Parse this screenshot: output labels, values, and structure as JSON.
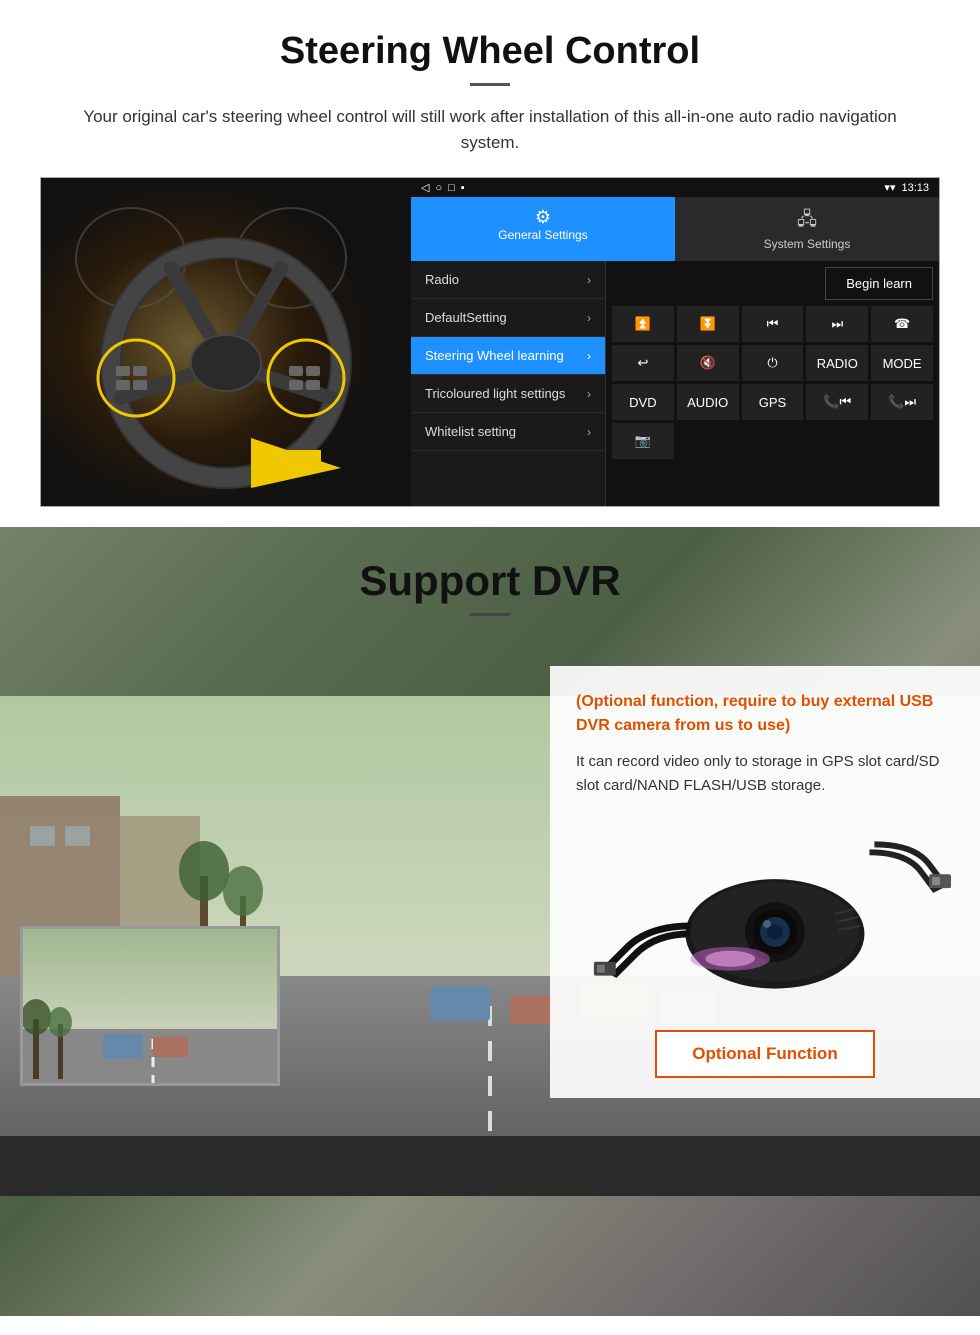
{
  "section1": {
    "title": "Steering Wheel Control",
    "subtitle": "Your original car's steering wheel control will still work after installation of this all-in-one auto radio navigation system.",
    "statusbar": {
      "time": "13:13",
      "icons": [
        "▾",
        "▾",
        "▾"
      ]
    },
    "tabs": [
      {
        "label": "General Settings",
        "active": true
      },
      {
        "label": "System Settings",
        "active": false
      }
    ],
    "menu_items": [
      {
        "label": "Radio",
        "active": false
      },
      {
        "label": "DefaultSetting",
        "active": false
      },
      {
        "label": "Steering Wheel learning",
        "active": true
      },
      {
        "label": "Tricoloured light settings",
        "active": false
      },
      {
        "label": "Whitelist setting",
        "active": false
      }
    ],
    "begin_learn": "Begin learn",
    "control_buttons": [
      {
        "label": "◀+",
        "symbol": "vol_up"
      },
      {
        "label": "◀−",
        "symbol": "vol_down"
      },
      {
        "label": "⏮",
        "symbol": "prev"
      },
      {
        "label": "⏭",
        "symbol": "next"
      },
      {
        "label": "☎",
        "symbol": "call"
      },
      {
        "label": "↩",
        "symbol": "back"
      },
      {
        "label": "🔇",
        "symbol": "mute"
      },
      {
        "label": "⏻",
        "symbol": "power"
      },
      {
        "label": "RADIO",
        "symbol": "radio"
      },
      {
        "label": "MODE",
        "symbol": "mode"
      },
      {
        "label": "DVD",
        "symbol": "dvd"
      },
      {
        "label": "AUDIO",
        "symbol": "audio"
      },
      {
        "label": "GPS",
        "symbol": "gps"
      },
      {
        "label": "📞⏮",
        "symbol": "call_prev"
      },
      {
        "label": "📞⏭",
        "symbol": "call_next"
      }
    ]
  },
  "section2": {
    "title": "Support DVR",
    "info_orange": "(Optional function, require to buy external USB DVR camera from us to use)",
    "info_text": "It can record video only to storage in GPS slot card/SD slot card/NAND FLASH/USB storage.",
    "optional_btn": "Optional Function"
  }
}
